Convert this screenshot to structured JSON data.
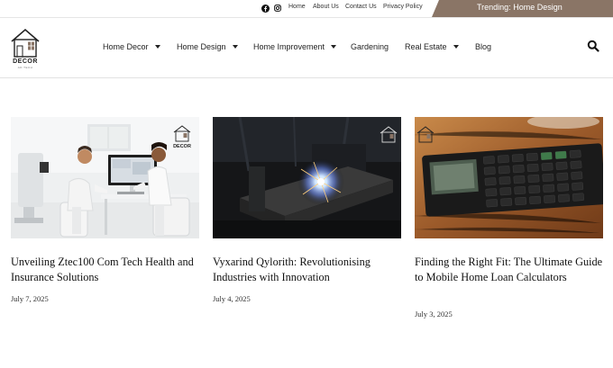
{
  "topbar": {
    "social_icons": [
      "facebook-icon",
      "instagram-icon"
    ],
    "links": [
      "Home",
      "About Us",
      "Contact Us",
      "Privacy Policy"
    ],
    "trending": "Trending: Home Design",
    "trending_color": "#8a7566"
  },
  "logo": {
    "brand": "DECOR",
    "tagline": "AD TECH"
  },
  "nav": {
    "items": [
      {
        "label": "Home Decor",
        "has_dropdown": true
      },
      {
        "label": "Home Design",
        "has_dropdown": true
      },
      {
        "label": "Home Improvement",
        "has_dropdown": true
      },
      {
        "label": "Gardening",
        "has_dropdown": false
      },
      {
        "label": "Real Estate",
        "has_dropdown": true
      },
      {
        "label": "Blog",
        "has_dropdown": false
      }
    ],
    "search_icon": "search-icon"
  },
  "posts": [
    {
      "title": "Unveiling Ztec100 Com Tech Health and Insurance Solutions",
      "date": "July 7, 2025"
    },
    {
      "title": "Vyxarind Qylorith: Revolutionising Industries with Innovation",
      "date": "July 4, 2025"
    },
    {
      "title": "Finding the Right Fit: The Ultimate Guide to Mobile Home Loan Calculators",
      "date": "July 3, 2025"
    }
  ]
}
